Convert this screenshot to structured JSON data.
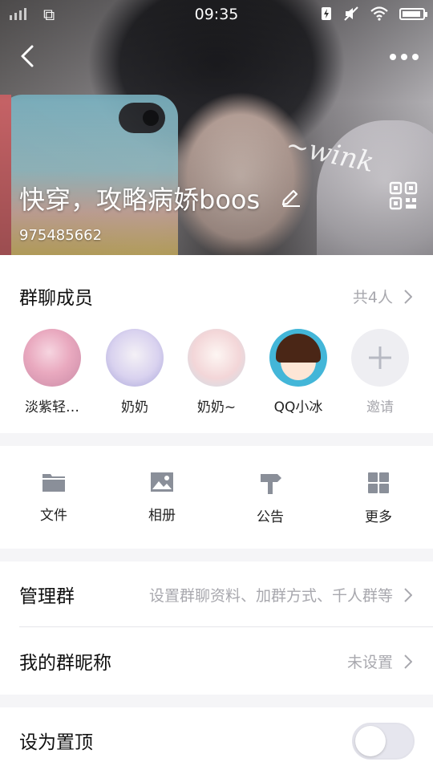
{
  "status_bar": {
    "time": "09:35"
  },
  "header": {
    "group_name": "快穿，攻略病娇boos",
    "group_id": "975485662",
    "decoration_text": "~wink"
  },
  "members": {
    "title": "群聊成员",
    "count_text": "共4人",
    "list": [
      {
        "name": "淡紫轻…"
      },
      {
        "name": "奶奶"
      },
      {
        "name": "奶奶~"
      },
      {
        "name": "QQ小冰"
      }
    ],
    "invite_label": "邀请"
  },
  "tools": [
    {
      "label": "文件",
      "icon": "folder-icon"
    },
    {
      "label": "相册",
      "icon": "photo-icon"
    },
    {
      "label": "公告",
      "icon": "signpost-icon"
    },
    {
      "label": "更多",
      "icon": "grid-icon"
    }
  ],
  "manage": {
    "title": "管理群",
    "detail": "设置群聊资料、加群方式、千人群等"
  },
  "nickname": {
    "title": "我的群昵称",
    "value": "未设置"
  },
  "pin": {
    "title": "设为置顶",
    "enabled": false
  },
  "colors": {
    "icon_gray": "#8a8f99",
    "secondary_text": "#a8a8ae",
    "background": "#f5f5f7"
  }
}
